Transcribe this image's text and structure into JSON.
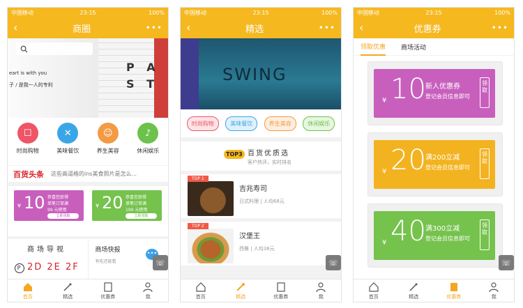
{
  "status_bar": {
    "carrier": "中国移动",
    "time": "23:15",
    "battery": "100%"
  },
  "phone1": {
    "title": "商圈",
    "banner_text1": "eart is with you",
    "banner_text2": "子 / 是我一人的专利",
    "banner_big": "P A S T",
    "categories": [
      {
        "label": "时尚购物",
        "color": "#ef5566",
        "icon": "bag-icon"
      },
      {
        "label": "美味餐饮",
        "color": "#3aa6e8",
        "icon": "cutlery-icon"
      },
      {
        "label": "养生美容",
        "color": "#f39a43",
        "icon": "face-icon"
      },
      {
        "label": "休闲娱乐",
        "color": "#6cc24a",
        "icon": "mic-icon"
      }
    ],
    "headline_logo": "百货头条",
    "headline_text": "这些高逼格的ins美食照片是怎么...",
    "coupon_a": {
      "num": "10",
      "yen": "¥",
      "line1": "恭喜您获得",
      "line2": "单笔订单满",
      "line3": "99 元使用",
      "btn": "立即领取"
    },
    "coupon_b": {
      "num": "20",
      "yen": "¥",
      "line1": "恭喜您获得",
      "line2": "单笔订单满",
      "line3": "199 元使用",
      "btn": "立即领取"
    },
    "mall_guide": "商场导视",
    "floors": "2D 2E 2F",
    "floor_p": "P",
    "news_title": "商场快报",
    "news_sub": "有吃还能看"
  },
  "phone2": {
    "title": "精选",
    "banner_word": "SWING",
    "pills": [
      {
        "label": "时尚购物",
        "color": "#ef5566",
        "bg": "#fde4e6"
      },
      {
        "label": "美味餐饮",
        "color": "#3aa6e8",
        "bg": "#e1f1fc"
      },
      {
        "label": "养生美容",
        "color": "#f39a43",
        "bg": "#fdeedf"
      },
      {
        "label": "休闲娱乐",
        "color": "#6cc24a",
        "bg": "#e7f6e0"
      }
    ],
    "top3_badge": "TOP3",
    "top3_title": "百货优质选",
    "top3_sub": "客户热评，实时排名",
    "restaurants": [
      {
        "badge": "TOP 1",
        "name": "吉兆寿司",
        "sub": "日式料理 | 人均68元"
      },
      {
        "badge": "TOP 2",
        "name": "汉堡王",
        "sub": "西餐 | 人均38元"
      }
    ]
  },
  "phone3": {
    "title": "优惠券",
    "subtabs": [
      "领取优惠",
      "商场活动"
    ],
    "coupons": [
      {
        "num": "10",
        "line1": "新人优惠券",
        "line2": "登记会员信息即可",
        "color": "#c85fbd"
      },
      {
        "num": "20",
        "line1": "满200立减",
        "line2": "登记会员信息即可",
        "color": "#f3b320"
      },
      {
        "num": "40",
        "line1": "满300立减",
        "line2": "登记会员信息即可",
        "color": "#75c24d"
      }
    ],
    "yen": "¥",
    "receive": "领取"
  },
  "tabbar": [
    "首页",
    "精选",
    "优惠券",
    "我"
  ],
  "colors": {
    "accent": "#f5b81f",
    "active_tab": "#f5a623"
  }
}
